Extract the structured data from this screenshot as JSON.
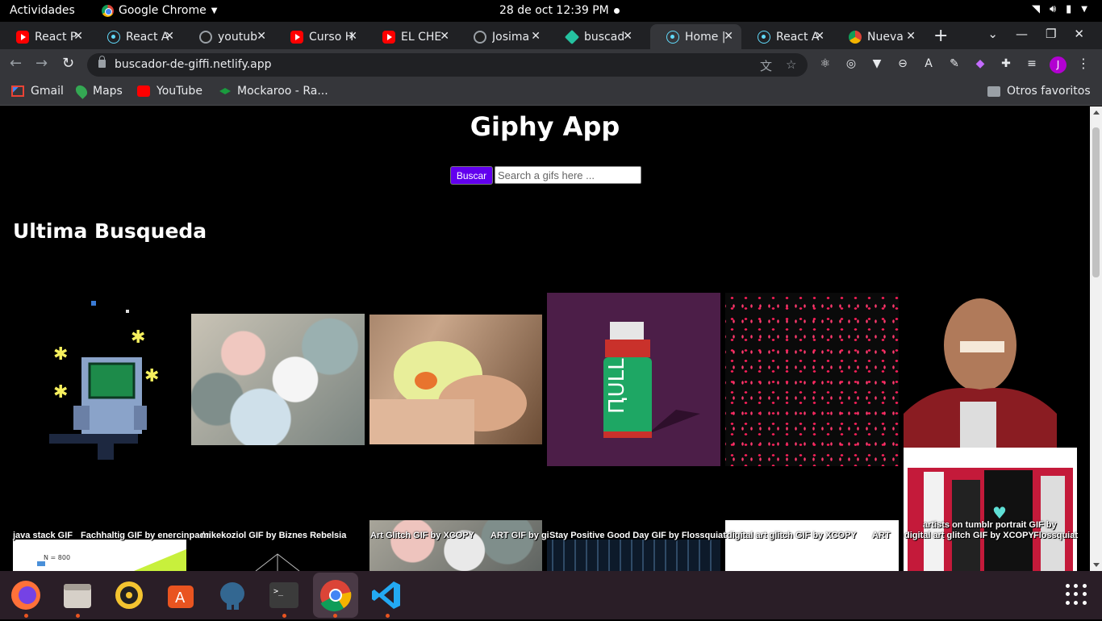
{
  "topbar": {
    "activities": "Actividades",
    "app_name": "Google Chrome",
    "clock": "28 de oct  12:39 PM"
  },
  "tabs": [
    {
      "title": "React P",
      "icon": "youtube-icon"
    },
    {
      "title": "React A",
      "icon": "react-icon"
    },
    {
      "title": "youtub",
      "icon": "github-icon"
    },
    {
      "title": "Curso H",
      "icon": "youtube-icon"
    },
    {
      "title": "EL CHE",
      "icon": "youtube-icon"
    },
    {
      "title": "Josima",
      "icon": "github-icon"
    },
    {
      "title": "buscad",
      "icon": "netlify-icon"
    },
    {
      "title": "Home |",
      "icon": "react-icon",
      "active": true
    },
    {
      "title": "React A",
      "icon": "react-icon"
    },
    {
      "title": "Nueva",
      "icon": "chrome-icon"
    }
  ],
  "toolbar": {
    "url": "buscador-de-giffi.netlify.app",
    "profile_initial": "J"
  },
  "bookmarks": {
    "items": [
      "Gmail",
      "Maps",
      "YouTube",
      "Mockaroo - Ra..."
    ],
    "other": "Otros favoritos"
  },
  "page": {
    "title": "Giphy App",
    "search_button": "Buscar",
    "search_placeholder": "Search a gifs here ...",
    "section_title": "Ultima Busqueda",
    "gifs": [
      {
        "caption": "java stack GIF"
      },
      {
        "caption": "Fachhaltig GIF by enercinpada"
      },
      {
        "caption": "mikekoziol GIF by Biznes Rebelsia"
      },
      {
        "caption": "Art Glitch GIF by XCOPY"
      },
      {
        "caption": "ART GIF by gi"
      },
      {
        "caption": "Stay Positive Good Day GIF by Flossquiat"
      },
      {
        "caption": "digital art glitch GIF by XCOPY"
      },
      {
        "caption": "ART"
      },
      {
        "caption": "artists on tumblr portrait GIF by"
      },
      {
        "caption": "digital art glitch GIF by XCOPY"
      },
      {
        "caption": "Flossquiat"
      }
    ]
  },
  "colors": {
    "buscar_button": "#6200ee",
    "page_background": "#000000",
    "chrome_dark": "#202124",
    "chrome_toolbar": "#35363a",
    "dock": "#2a1e27"
  }
}
